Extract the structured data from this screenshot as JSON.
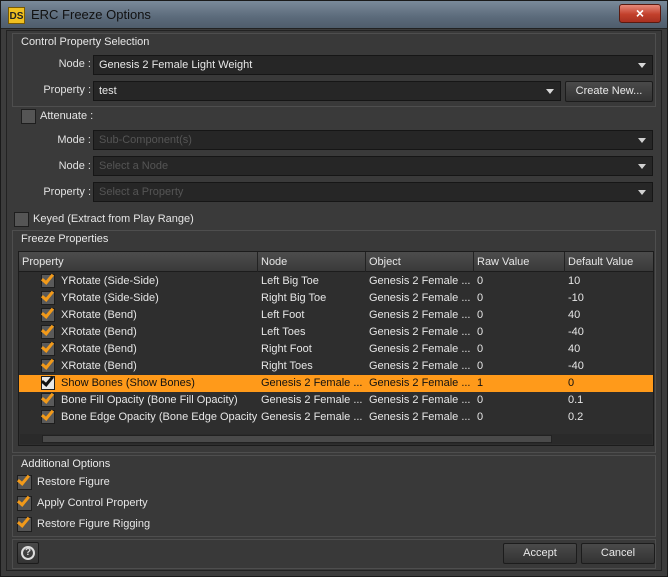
{
  "window": {
    "title": "ERC Freeze Options",
    "app_icon": "DS",
    "close_symbol": "×"
  },
  "control_property": {
    "group_title": "Control Property Selection",
    "node_label": "Node :",
    "node_value": "Genesis 2 Female Light Weight",
    "property_label": "Property :",
    "property_value": "test",
    "create_new_label": "Create New..."
  },
  "attenuate": {
    "label": "Attenuate :",
    "checked": false,
    "mode_label": "Mode :",
    "mode_placeholder": "Sub-Component(s)",
    "node_label": "Node :",
    "node_placeholder": "Select a Node",
    "property_label": "Property :",
    "property_placeholder": "Select a Property"
  },
  "keyed": {
    "label": "Keyed (Extract from Play Range)",
    "checked": false
  },
  "freeze_properties": {
    "group_title": "Freeze Properties",
    "columns": [
      "Property",
      "Node",
      "Object",
      "Raw Value",
      "Default Value"
    ],
    "rows": [
      {
        "checked": true,
        "property": "YRotate (Side-Side)",
        "node": "Left Big Toe",
        "object": "Genesis 2 Female ...",
        "raw": "0",
        "default": "10",
        "selected": false
      },
      {
        "checked": true,
        "property": "YRotate (Side-Side)",
        "node": "Right Big Toe",
        "object": "Genesis 2 Female ...",
        "raw": "0",
        "default": "-10",
        "selected": false
      },
      {
        "checked": true,
        "property": "XRotate (Bend)",
        "node": "Left Foot",
        "object": "Genesis 2 Female ...",
        "raw": "0",
        "default": "40",
        "selected": false
      },
      {
        "checked": true,
        "property": "XRotate (Bend)",
        "node": "Left Toes",
        "object": "Genesis 2 Female ...",
        "raw": "0",
        "default": "-40",
        "selected": false
      },
      {
        "checked": true,
        "property": "XRotate (Bend)",
        "node": "Right Foot",
        "object": "Genesis 2 Female ...",
        "raw": "0",
        "default": "40",
        "selected": false
      },
      {
        "checked": true,
        "property": "XRotate (Bend)",
        "node": "Right Toes",
        "object": "Genesis 2 Female ...",
        "raw": "0",
        "default": "-40",
        "selected": false
      },
      {
        "checked": true,
        "property": "Show Bones (Show Bones)",
        "node": "Genesis 2 Female ...",
        "object": "Genesis 2 Female ...",
        "raw": "1",
        "default": "0",
        "selected": true
      },
      {
        "checked": true,
        "property": "Bone Fill Opacity (Bone Fill Opacity)",
        "node": "Genesis 2 Female ...",
        "object": "Genesis 2 Female ...",
        "raw": "0",
        "default": "0.1",
        "selected": false
      },
      {
        "checked": true,
        "property": "Bone Edge Opacity (Bone Edge Opacity)",
        "node": "Genesis 2 Female ...",
        "object": "Genesis 2 Female ...",
        "raw": "0",
        "default": "0.2",
        "selected": false
      }
    ]
  },
  "additional_options": {
    "group_title": "Additional Options",
    "options": [
      {
        "label": "Restore Figure",
        "checked": true
      },
      {
        "label": "Apply Control Property",
        "checked": true
      },
      {
        "label": "Restore Figure Rigging",
        "checked": true
      }
    ]
  },
  "footer": {
    "help_symbol": "?",
    "accept_label": "Accept",
    "cancel_label": "Cancel"
  },
  "colors": {
    "accent": "#ff9a1a",
    "check": "#f29a1a",
    "background": "#3a3a3a"
  }
}
